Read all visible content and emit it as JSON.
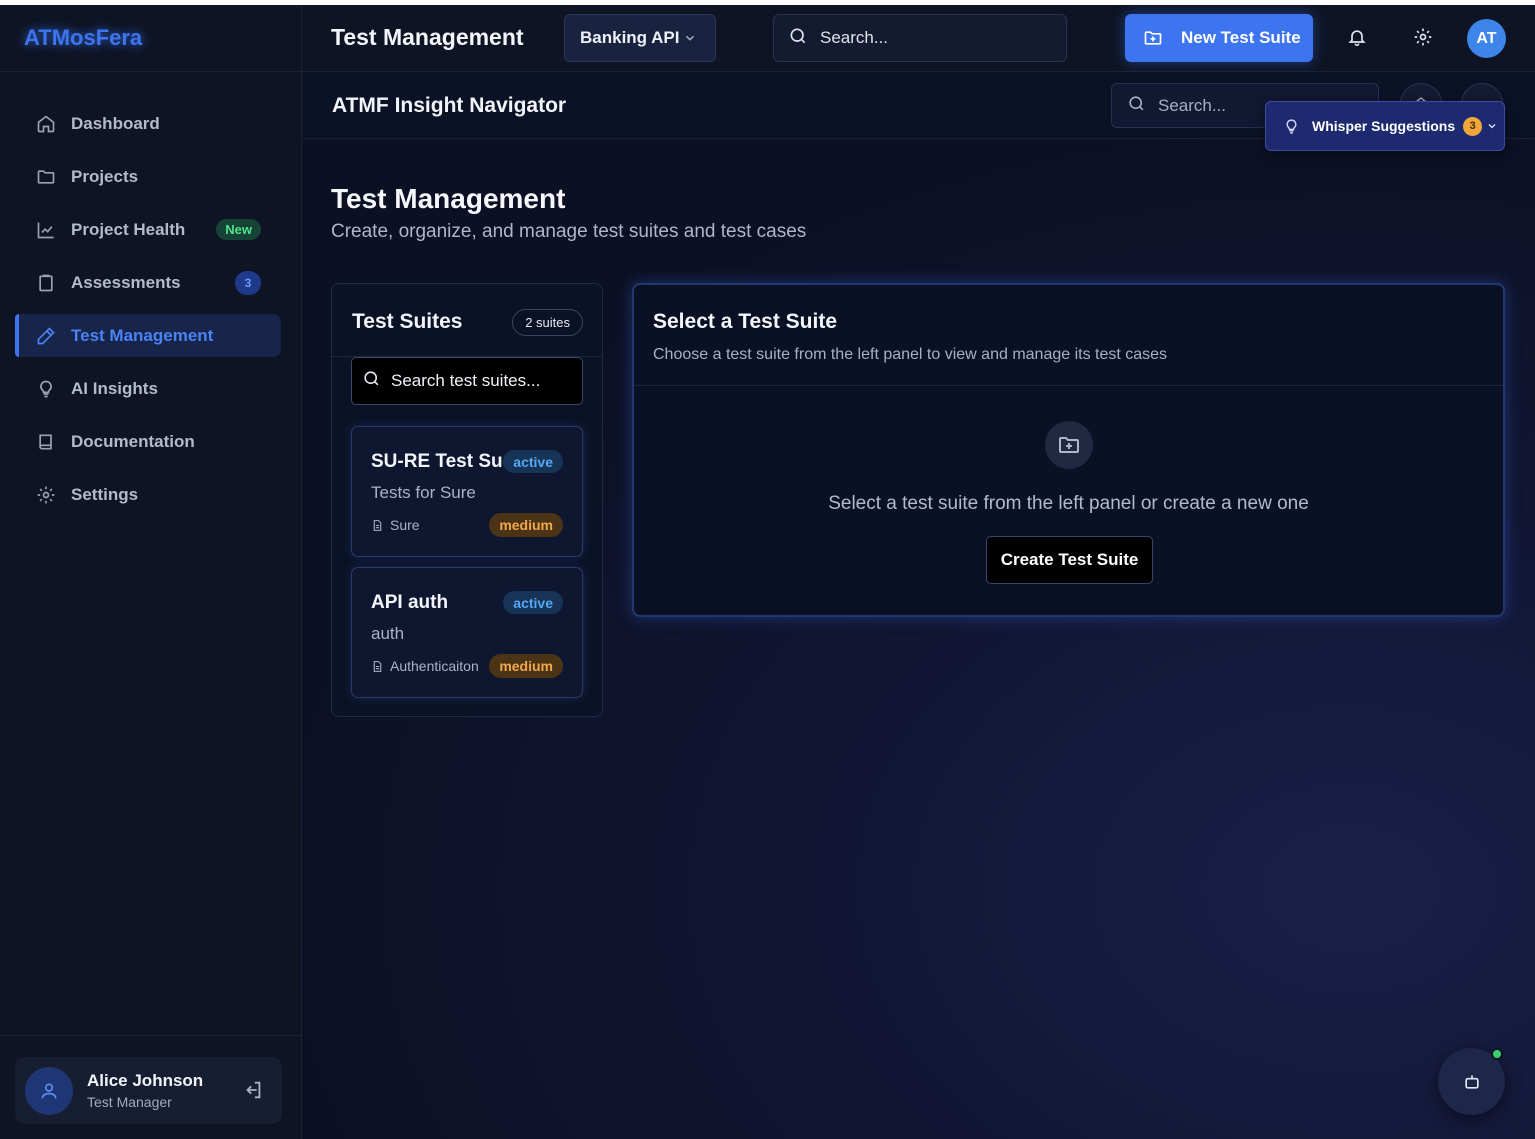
{
  "brand": "ATMosFera",
  "sidebar": {
    "items": [
      {
        "label": "Dashboard",
        "icon": "home-icon"
      },
      {
        "label": "Projects",
        "icon": "folder-icon"
      },
      {
        "label": "Project Health",
        "icon": "line-chart-icon",
        "badge": "New"
      },
      {
        "label": "Assessments",
        "icon": "clipboard-icon",
        "badge": "3"
      },
      {
        "label": "Test Management",
        "icon": "pencil-icon",
        "active": true
      },
      {
        "label": "AI Insights",
        "icon": "lightbulb-icon"
      },
      {
        "label": "Documentation",
        "icon": "book-icon"
      },
      {
        "label": "Settings",
        "icon": "gear-icon"
      }
    ]
  },
  "user": {
    "name": "Alice Johnson",
    "role": "Test Manager"
  },
  "header": {
    "title": "Test Management",
    "project": "Banking API",
    "search_placeholder": "Search...",
    "new_suite_label": "New Test Suite",
    "avatar_initials": "AT"
  },
  "navigator": {
    "title": "ATMF Insight Navigator",
    "search_placeholder": "Search...",
    "whisper_label": "Whisper Suggestions",
    "whisper_count": "3"
  },
  "page": {
    "title": "Test Management",
    "subtitle": "Create, organize, and manage test suites and test cases"
  },
  "suites": {
    "title": "Test Suites",
    "count_label": "2 suites",
    "search_placeholder": "Search test suites...",
    "items": [
      {
        "name": "SU-RE Test Suite",
        "status": "active",
        "description": "Tests for Sure",
        "module": "Sure",
        "priority": "medium"
      },
      {
        "name": "API auth",
        "status": "active",
        "description": "auth",
        "module": "Authenticaiton",
        "priority": "medium"
      }
    ]
  },
  "detail": {
    "title": "Select a Test Suite",
    "subtitle": "Choose a test suite from the left panel to view and manage its test cases",
    "empty_text": "Select a test suite from the left panel or create a new one",
    "create_label": "Create Test Suite"
  },
  "colors": {
    "accent": "#3d74f0",
    "background": "#0c1020",
    "active_pill": "#54a8f5",
    "medium_pill": "#f0a84a"
  }
}
